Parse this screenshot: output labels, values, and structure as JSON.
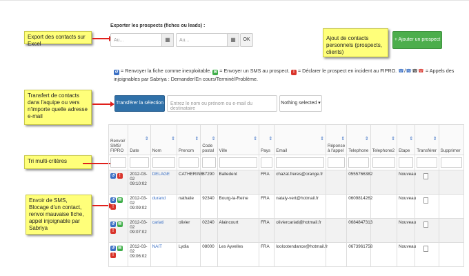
{
  "notes": {
    "export": "Export des contacts sur Excel",
    "transfer": "Transfert de contacts dans l'aquipe ou vers n'importe quelle adresse e-mail",
    "sort": "Tri multi-critères",
    "sms": "Envoir de SMS, Blocage d'un contact, renvoi mauvaise fiche, appel injoignable par Sabriya",
    "add": "Ajout de contacts personnels (prospects, clients)"
  },
  "export": {
    "title": "Exporter les prospects (fiches ou leads) :",
    "from_placeholder": "Au...",
    "to_placeholder": "Au...",
    "ok_label": "OK",
    "calendar_glyph": "▦"
  },
  "add_button": {
    "label": "Ajouter un prospect",
    "icon": "+"
  },
  "legend": {
    "renvoyer": "= Renvoyer la fiche comme inexploitable.",
    "sms": "= Envoyer un SMS au prospect.",
    "declarer": "= Déclarer le prospect en incident au FIPRO.",
    "appels": "= Appels des",
    "line2": "injoignables par Sabriya : Demander/En cours/Terminé/Problème."
  },
  "transfer": {
    "button": "Transférer la sélection à",
    "placeholder": "Entrez le nom ou prénom ou e-mail du destinataire",
    "select": "Nothing selected"
  },
  "table": {
    "columns": [
      "Renvoi/ SMS/ FIPRO",
      "Date",
      "Nom",
      "Prenom",
      "Code postal",
      "Ville",
      "Pays",
      "Email",
      "Réponse à l'appel",
      "Telephone",
      "Telephone2",
      "Etape",
      "Transférer",
      "Supprimer"
    ],
    "rows": [
      {
        "date": "2012-03-02",
        "time": "09:10:02",
        "nom": "DELAGE",
        "prenom": "CATHERINE",
        "cp": "87290",
        "ville": "Balledent",
        "pays": "FRA",
        "email": "chazat.freres@orange.fr",
        "tel": "0555766382",
        "etape": "Nouveau"
      },
      {
        "date": "2012-03-02",
        "time": "09:09:02",
        "nom": "durand",
        "prenom": "nathalie",
        "cp": "92340",
        "ville": "Bourg-la-Reine",
        "pays": "FRA",
        "email": "nataly-vert@hotmail.fr",
        "tel": "0609814262",
        "etape": "Nouveau"
      },
      {
        "date": "2012-03-02",
        "time": "09:07:02",
        "nom": "cariati",
        "prenom": "olivier",
        "cp": "02240",
        "ville": "Alaincourt",
        "pays": "FRA",
        "email": "oliviercariati@hotmail.fr",
        "tel": "0684847313",
        "etape": "Nouveau"
      },
      {
        "date": "2012-03-02",
        "time": "09:06:02",
        "nom": "NAIT",
        "prenom": "Lydia",
        "cp": "08000",
        "ville": "Les Ayvelles",
        "pays": "FRA",
        "email": "loolootendance@hotmail.fr",
        "tel": "0673961758",
        "etape": "Nouveau"
      }
    ]
  }
}
